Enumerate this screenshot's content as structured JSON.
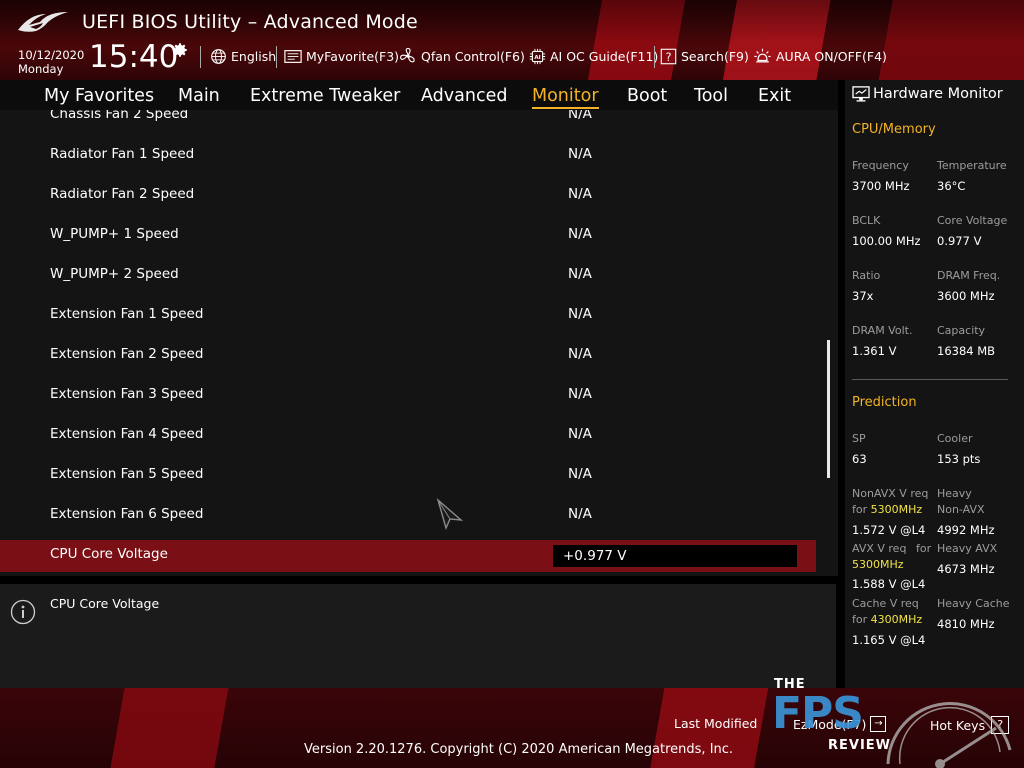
{
  "header": {
    "title": "UEFI BIOS Utility – Advanced Mode",
    "date": "10/12/2020",
    "day": "Monday",
    "time": "15:40",
    "toolbar": [
      {
        "label": "English",
        "icon": "globe-icon"
      },
      {
        "label": "MyFavorite(F3)",
        "icon": "favorite-icon"
      },
      {
        "label": "Qfan Control(F6)",
        "icon": "fan-icon"
      },
      {
        "label": "AI OC Guide(F11)",
        "icon": "ai-chip-icon"
      },
      {
        "label": "Search(F9)",
        "icon": "search-help-icon"
      },
      {
        "label": "AURA ON/OFF(F4)",
        "icon": "aura-light-icon"
      }
    ]
  },
  "menu": {
    "tabs": [
      "My Favorites",
      "Main",
      "Extreme Tweaker",
      "Advanced",
      "Monitor",
      "Boot",
      "Tool",
      "Exit"
    ],
    "active": "Monitor"
  },
  "settings": {
    "rows": [
      {
        "label": "Chassis Fan 2 Speed",
        "value": "N/A"
      },
      {
        "label": "Radiator Fan 1 Speed",
        "value": "N/A"
      },
      {
        "label": "Radiator Fan 2 Speed",
        "value": "N/A"
      },
      {
        "label": "W_PUMP+ 1 Speed",
        "value": "N/A"
      },
      {
        "label": "W_PUMP+ 2 Speed",
        "value": "N/A"
      },
      {
        "label": "Extension Fan 1 Speed",
        "value": "N/A"
      },
      {
        "label": "Extension Fan 2 Speed",
        "value": "N/A"
      },
      {
        "label": "Extension Fan 3 Speed",
        "value": "N/A"
      },
      {
        "label": "Extension Fan 4 Speed",
        "value": "N/A"
      },
      {
        "label": "Extension Fan 5 Speed",
        "value": "N/A"
      },
      {
        "label": "Extension Fan 6 Speed",
        "value": "N/A"
      }
    ],
    "selected": {
      "label": "CPU Core Voltage",
      "value": "+0.977 V"
    }
  },
  "help": {
    "text": "CPU Core Voltage"
  },
  "hw_monitor": {
    "title": "Hardware Monitor",
    "cpu_memory": {
      "title": "CPU/Memory",
      "frequency_label": "Frequency",
      "frequency": "3700 MHz",
      "temperature_label": "Temperature",
      "temperature": "36°C",
      "bclk_label": "BCLK",
      "bclk": "100.00 MHz",
      "core_voltage_label": "Core Voltage",
      "core_voltage": "0.977 V",
      "ratio_label": "Ratio",
      "ratio": "37x",
      "dram_freq_label": "DRAM Freq.",
      "dram_freq": "3600 MHz",
      "dram_volt_label": "DRAM Volt.",
      "dram_volt": "1.361 V",
      "capacity_label": "Capacity",
      "capacity": "16384 MB"
    },
    "prediction": {
      "title": "Prediction",
      "sp_label": "SP",
      "sp": "63",
      "cooler_label": "Cooler",
      "cooler": "153 pts",
      "nonavx_req_label": "NonAVX V req",
      "for_word": "for",
      "nonavx_freq": "5300MHz",
      "nonavx_volt": "1.572 V @L4",
      "heavy_label": "Heavy",
      "heavy_nonavx_label": "Non-AVX",
      "heavy_nonavx": "4992 MHz",
      "avx_req_label": "AVX V req",
      "avx_freq": "5300MHz",
      "avx_volt": "1.588 V @L4",
      "heavy_avx_label": "Heavy AVX",
      "heavy_avx": "4673 MHz",
      "cache_req_label": "Cache V req",
      "cache_freq": "4300MHz",
      "cache_volt": "1.165 V @L4",
      "heavy_cache_label": "Heavy Cache",
      "heavy_cache": "4810 MHz"
    }
  },
  "footer": {
    "last_modified": "Last Modified",
    "ezmode": "EzMode(F7)",
    "hotkeys": "Hot Keys",
    "copyright": "Version 2.20.1276. Copyright (C) 2020 American Megatrends, Inc."
  },
  "watermark": {
    "line1": "THE",
    "line2": "FPS",
    "line3": "REVIEW"
  },
  "colors": {
    "accent": "#f2b326",
    "highlight": "#f1e24a",
    "selection": "#7a0f15",
    "brand_red": "#4a0709"
  }
}
